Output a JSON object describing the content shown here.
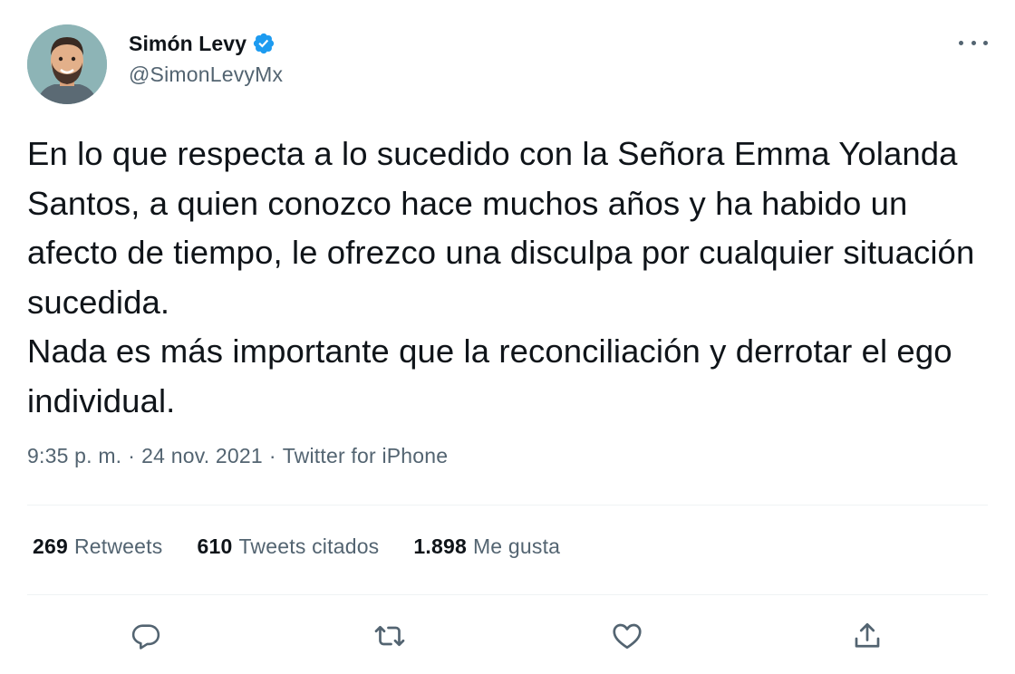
{
  "author": {
    "display_name": "Simón Levy",
    "handle": "@SimonLevyMx",
    "verified": true,
    "avatar_icon": "cartoon-avatar-icon"
  },
  "tweet": {
    "paragraphs": [
      "En lo que respecta a lo sucedido con la Señora Emma Yolanda Santos, a quien conozco hace muchos años y ha habido un afecto de tiempo, le ofrezco una disculpa por cualquier situación sucedida.",
      "Nada es más importante que la reconciliación y derrotar el ego individual."
    ],
    "time": "9:35 p. m.",
    "date": "24 nov. 2021",
    "source": "Twitter for iPhone",
    "separator": "·"
  },
  "stats": {
    "retweets": {
      "count": "269",
      "label": "Retweets"
    },
    "quotes": {
      "count": "610",
      "label": "Tweets citados"
    },
    "likes": {
      "count": "1.898",
      "label": "Me gusta"
    }
  },
  "actions": [
    "reply-icon",
    "retweet-icon",
    "like-icon",
    "share-icon"
  ],
  "colors": {
    "text_primary": "#0f1419",
    "text_secondary": "#536471",
    "verified_blue": "#1d9bf0",
    "divider": "#eff3f4"
  }
}
